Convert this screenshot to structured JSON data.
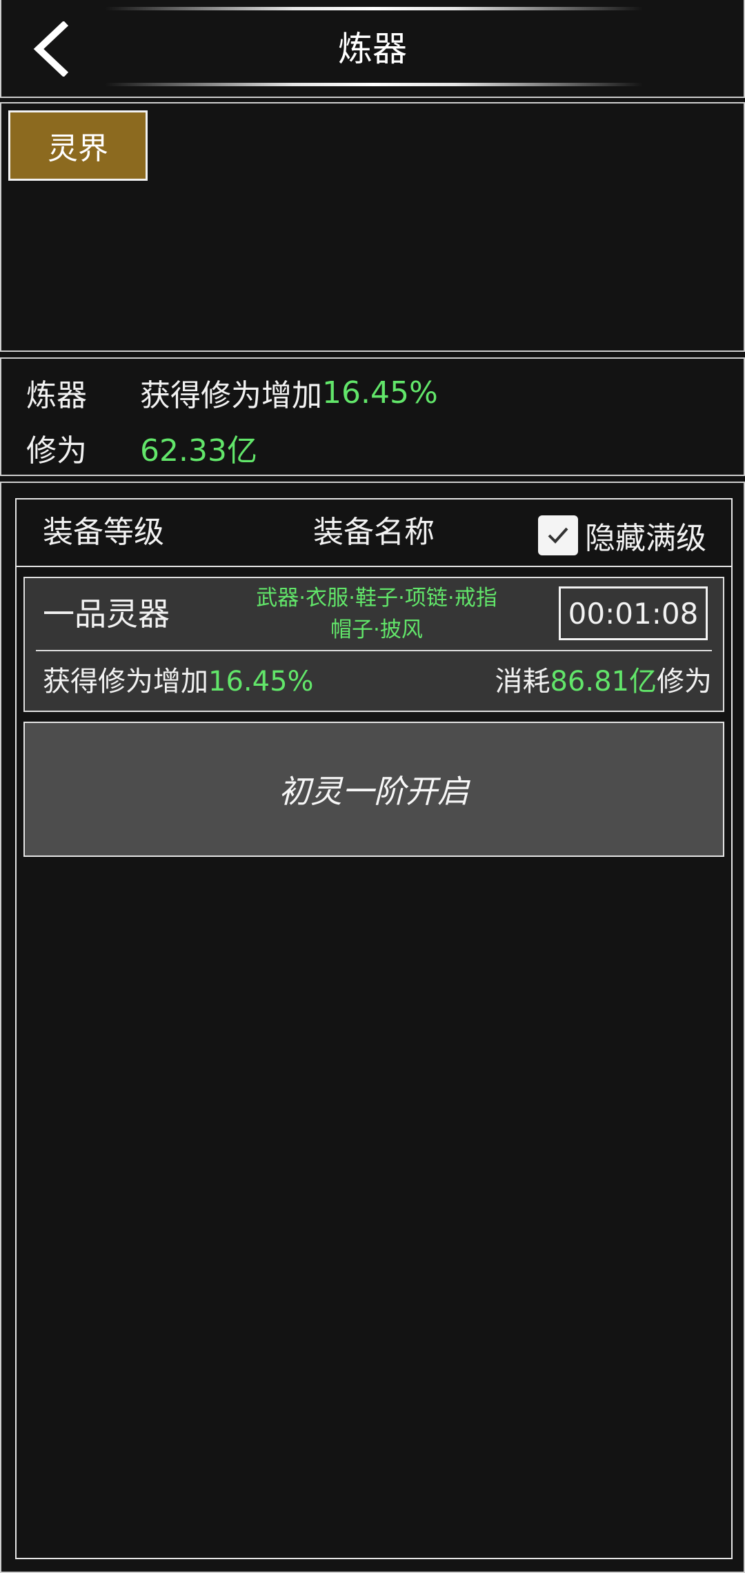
{
  "header": {
    "title": "炼器",
    "back_icon": "chevron-left-icon"
  },
  "realm_tabs": [
    {
      "label": "灵界",
      "active": true,
      "color": "#8c6a1f"
    }
  ],
  "stats": {
    "refine_label": "炼器",
    "refine_prefix": "获得修为增加",
    "refine_value": "16.45%",
    "cultivation_label": "修为",
    "cultivation_value": "62.33亿"
  },
  "list": {
    "col_level": "装备等级",
    "col_name": "装备名称",
    "hide_max_label": "隐藏满级",
    "hide_max_checked": true,
    "items": [
      {
        "grade": "一品灵器",
        "slots_line1": "武器·衣服·鞋子·项链·戒指",
        "slots_line2": "帽子·披风",
        "timer": "00:01:08",
        "gain_prefix": "获得修为增加",
        "gain_value": "16.45%",
        "cost_prefix": "消耗",
        "cost_value": "86.81亿",
        "cost_suffix": "修为"
      }
    ],
    "unlock_label": "初灵一阶开启"
  },
  "colors": {
    "accent_green": "#62e66a",
    "background": "#131313",
    "card": "#363636",
    "button": "#4d4d4d"
  }
}
